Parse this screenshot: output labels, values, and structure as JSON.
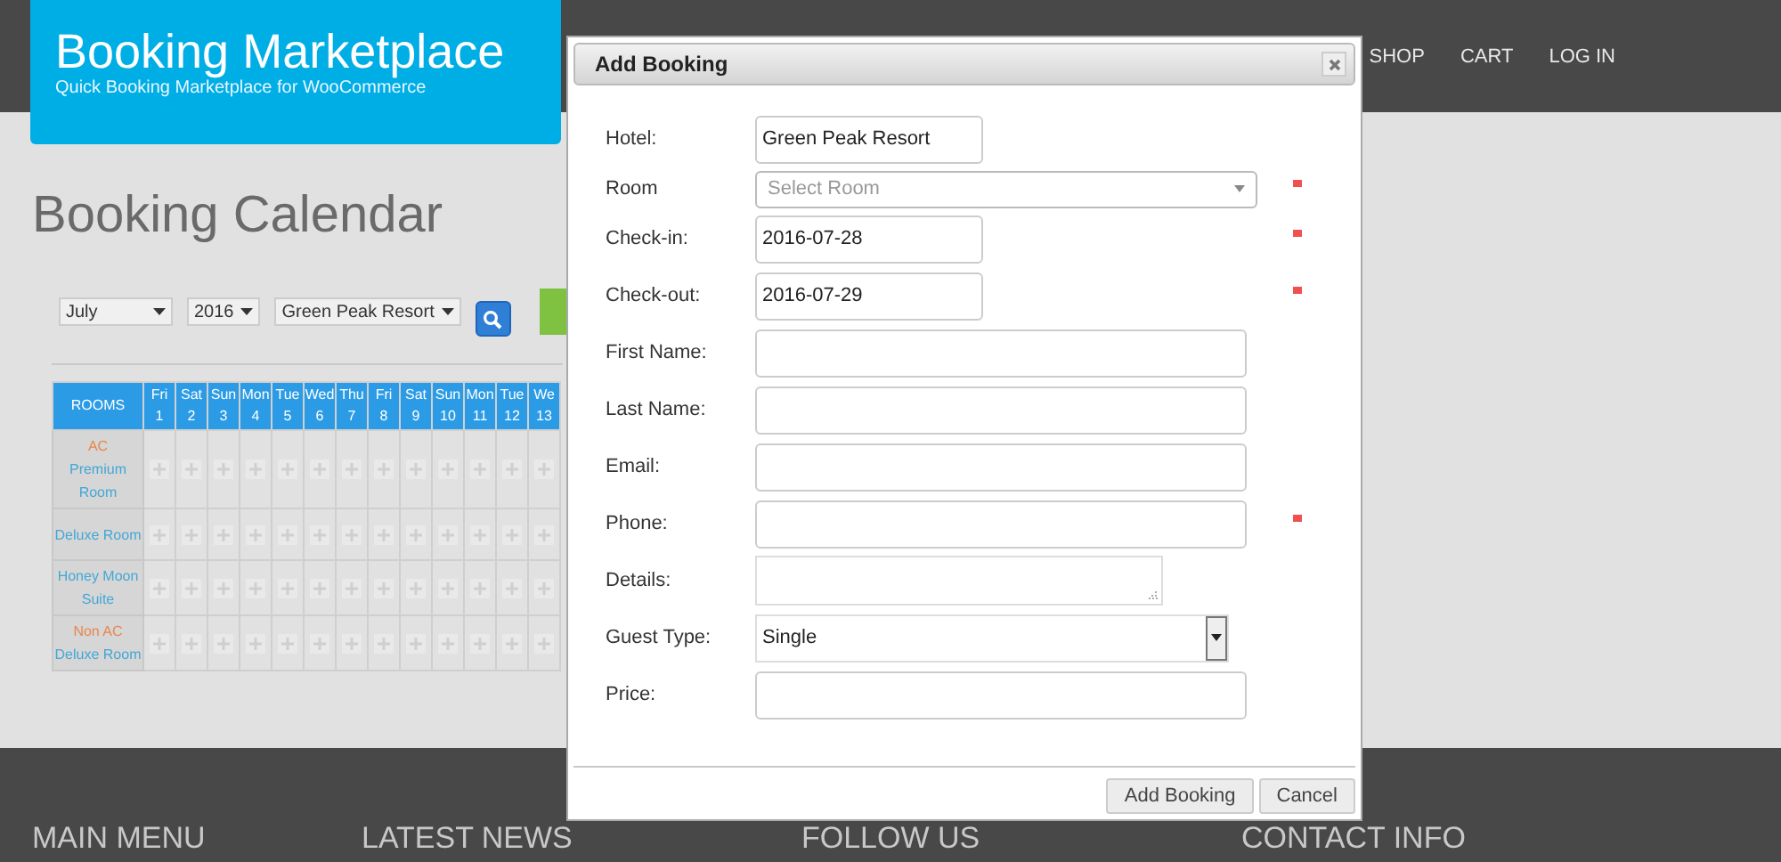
{
  "site": {
    "title": "Booking Marketplace",
    "tagline": "Quick Booking Marketplace for WooCommerce"
  },
  "nav": [
    "SHOP",
    "CART",
    "LOG IN"
  ],
  "page_title": "Booking Calendar",
  "filters": [
    {
      "value": "July"
    },
    {
      "value": "2016"
    },
    {
      "value": "Green Peak Resort"
    }
  ],
  "calendar": {
    "header": "ROOMS",
    "days": [
      {
        "weekday": "Fri",
        "day": "1"
      },
      {
        "weekday": "Sat",
        "day": "2"
      },
      {
        "weekday": "Sun",
        "day": "3"
      },
      {
        "weekday": "Mon",
        "day": "4"
      },
      {
        "weekday": "Tue",
        "day": "5"
      },
      {
        "weekday": "Wed",
        "day": "6"
      },
      {
        "weekday": "Thu",
        "day": "7"
      },
      {
        "weekday": "Fri",
        "day": "8"
      },
      {
        "weekday": "Sat",
        "day": "9"
      },
      {
        "weekday": "Sun",
        "day": "10"
      },
      {
        "weekday": "Mon",
        "day": "11"
      },
      {
        "weekday": "Tue",
        "day": "12"
      },
      {
        "weekday": "We",
        "day": "13"
      }
    ],
    "rooms": [
      {
        "tag": "AC",
        "name": "Premium Room"
      },
      {
        "name": "Deluxe Room"
      },
      {
        "name": "Honey Moon Suite"
      },
      {
        "tag": "Non AC",
        "name": "Deluxe Room"
      }
    ]
  },
  "dialog": {
    "title": "Add Booking",
    "fields": [
      {
        "label": "Hotel:",
        "kind": "text",
        "value": "Green Peak Resort",
        "required": false
      },
      {
        "label": "Room",
        "kind": "select",
        "placeholder": "Select Room",
        "required": true
      },
      {
        "label": "Check-in:",
        "kind": "text",
        "value": "2016-07-28",
        "required": true
      },
      {
        "label": "Check-out:",
        "kind": "text",
        "value": "2016-07-29",
        "required": true
      },
      {
        "label": "First Name:",
        "kind": "text",
        "required": false
      },
      {
        "label": "Last Name:",
        "kind": "text",
        "required": false
      },
      {
        "label": "Email:",
        "kind": "text",
        "required": false
      },
      {
        "label": "Phone:",
        "kind": "text",
        "required": true
      },
      {
        "label": "Details:",
        "kind": "textarea",
        "required": false
      },
      {
        "label": "Guest Type:",
        "kind": "dropdown",
        "value": "Single",
        "required": false
      },
      {
        "label": "Price:",
        "kind": "text",
        "required": false
      }
    ],
    "buttons": [
      "Add Booking",
      "Cancel"
    ]
  },
  "footer": [
    "MAIN MENU",
    "LATEST NEWS",
    "FOLLOW US",
    "CONTACT INFO"
  ]
}
